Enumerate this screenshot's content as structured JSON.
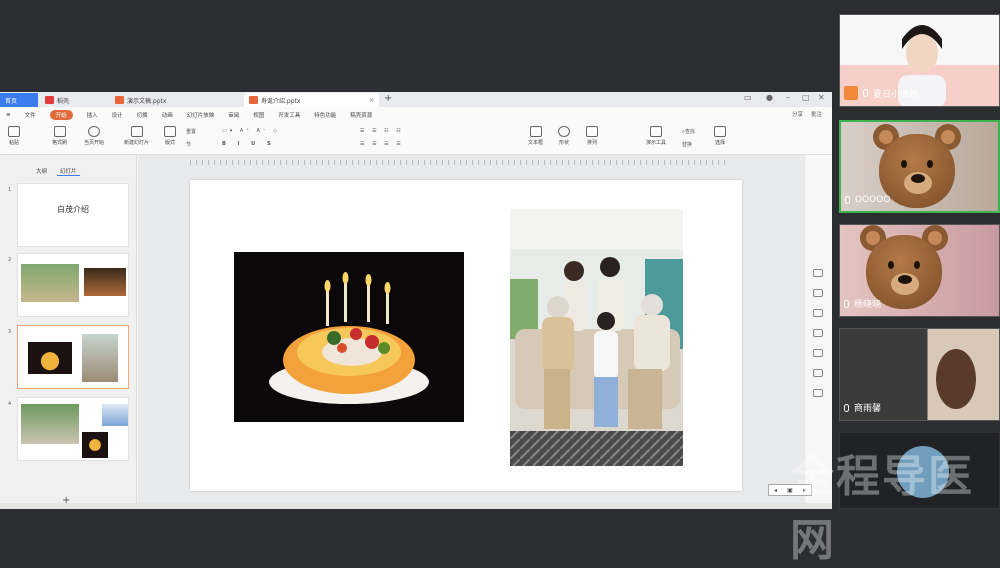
{
  "app": {
    "tabs": [
      {
        "label": "首页"
      },
      {
        "label": "稻壳"
      },
      {
        "label": "演示文稿.pptx"
      },
      {
        "label": "寿诞介绍.pptx"
      }
    ]
  },
  "menu": {
    "items": [
      "文件",
      "开始",
      "插入",
      "设计",
      "切换",
      "动画",
      "幻灯片放映",
      "审阅",
      "视图",
      "开发工具",
      "特色功能",
      "稿壳资源"
    ],
    "right": [
      "分享",
      "批注"
    ]
  },
  "ribbon": {
    "buttons": [
      "粘贴",
      "格式刷",
      "当页开始",
      "新建幻灯片",
      "版式",
      "节",
      "重置",
      "文本框",
      "形状",
      "排列",
      "演示工具",
      "查找",
      "替换",
      "选择"
    ]
  },
  "panel": {
    "tabs": [
      "大纲",
      "幻灯片"
    ],
    "thumbnails": [
      {
        "num": "1",
        "title": "白茂介绍"
      },
      {
        "num": "2",
        "title": ""
      },
      {
        "num": "3",
        "title": ""
      },
      {
        "num": "4",
        "title": ""
      }
    ]
  },
  "participants": [
    {
      "name": "夏日小清新"
    },
    {
      "name": "OOOOO"
    },
    {
      "name": "杨晓晓"
    },
    {
      "name": "商雨馨"
    }
  ],
  "watermark": "全程导医网",
  "colors": {
    "accent": "#3a7bf0",
    "active_tab": "#e06a3b",
    "speaking_border": "#3fb34f"
  }
}
